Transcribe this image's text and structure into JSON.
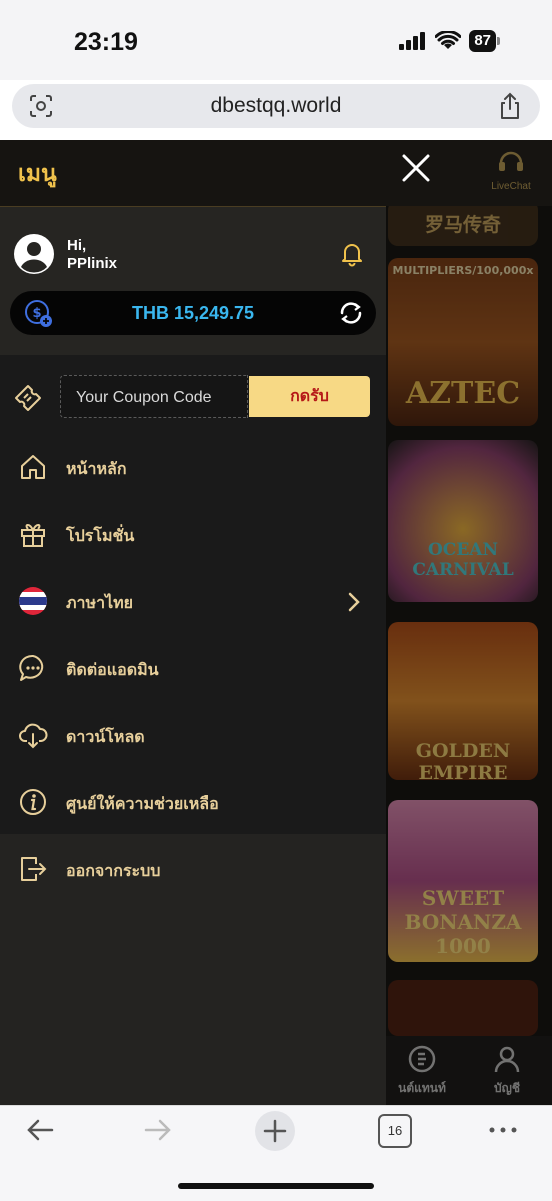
{
  "status_bar": {
    "time": "23:19",
    "battery": "87"
  },
  "browser": {
    "url": "dbestqq.world",
    "tab_count": "16"
  },
  "drawer": {
    "title": "เมนู",
    "greeting": "Hi,",
    "username": "PPlinix",
    "balance": "THB 15,249.75",
    "coupon": {
      "placeholder": "Your Coupon Code",
      "button": "กดรับ"
    },
    "menu_items": [
      {
        "label": "หน้าหลัก",
        "icon": "home-icon"
      },
      {
        "label": "โปรโมชั่น",
        "icon": "gift-icon"
      },
      {
        "label": "ภาษาไทย",
        "icon": "thai-flag-icon"
      },
      {
        "label": "ติดต่อแอดมิน",
        "icon": "chat-bubble-icon"
      },
      {
        "label": "ดาวน์โหลด",
        "icon": "cloud-download-icon"
      },
      {
        "label": "ศูนย์ให้ความช่วยเหลือ",
        "icon": "info-icon"
      }
    ],
    "logout": {
      "label": "ออกจากระบบ",
      "icon": "logout-icon"
    }
  },
  "background_page": {
    "livechat_label": "LiveChat",
    "tiles": [
      "罗马传奇",
      "MULTIPLIERS/100,000x",
      "AZTEC",
      "OCEAN CARNIVAL",
      "GOLDEN EMPIRE",
      "SWEET BONANZA 1000"
    ],
    "bottom_nav": [
      "นต์แทนท์",
      "บัญชี"
    ]
  },
  "colors": {
    "accent": "#f0c24c",
    "menu_text": "#e7cf9b",
    "balance_text": "#3ab7ef",
    "coupon_button_bg": "#f7d985",
    "coupon_button_text": "#b51818"
  }
}
